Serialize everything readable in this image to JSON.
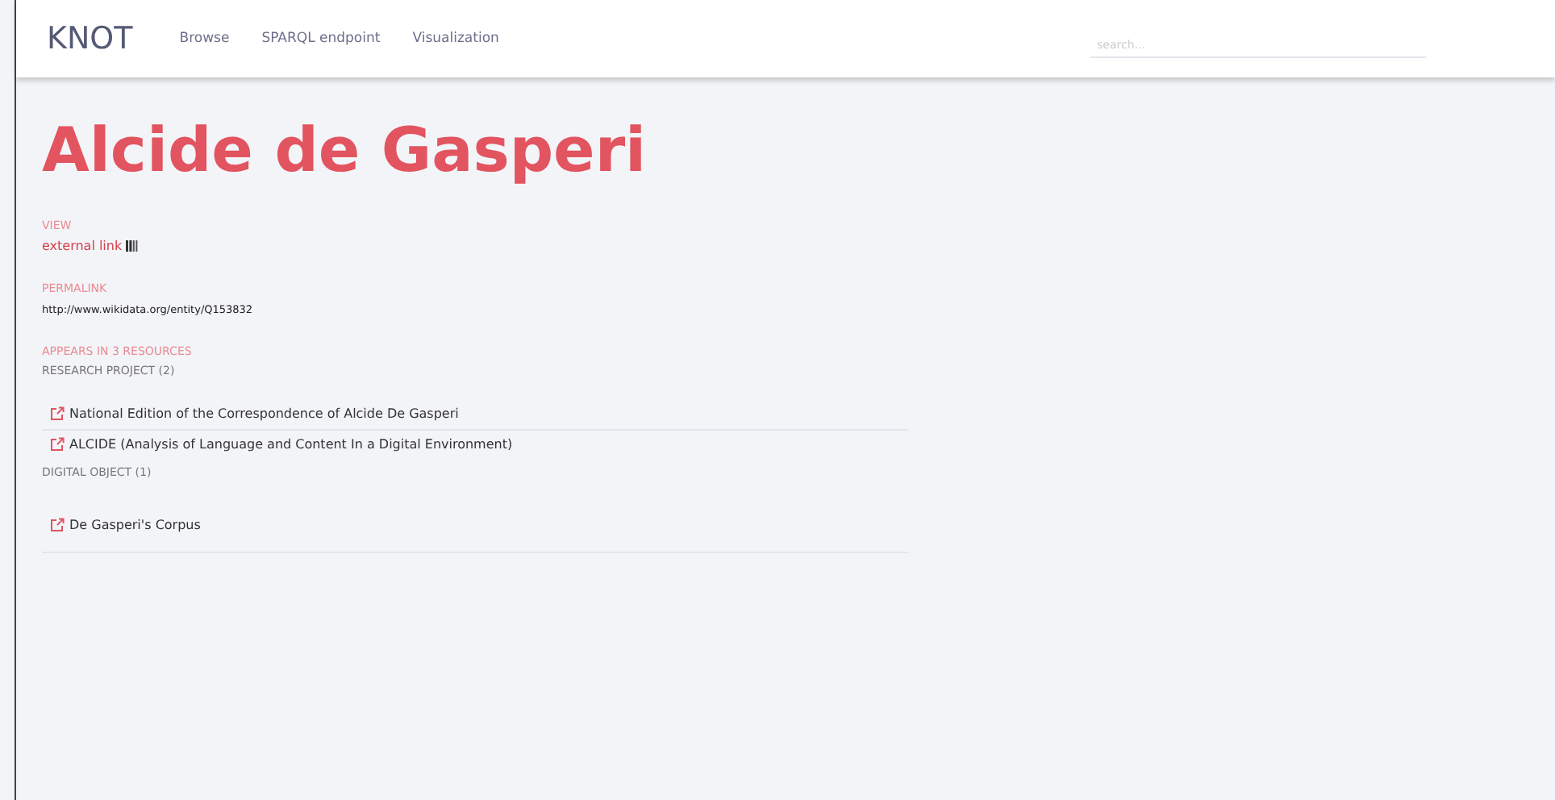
{
  "header": {
    "brand": "KNOT",
    "links": [
      "Browse",
      "SPARQL endpoint",
      "Visualization"
    ],
    "search": {
      "placeholder": "search..."
    }
  },
  "title": "Alcide de Gasperi",
  "view": {
    "label": "VIEW",
    "link": "external link"
  },
  "permalink": {
    "label": "PERMALINK",
    "url": "http://www.wikidata.org/entity/Q153832"
  },
  "appears": {
    "label": "APPEARS IN 3 RESOURCES",
    "groups": [
      {
        "heading": "RESEARCH PROJECT (2)",
        "items": [
          "National Edition of the Correspondence of Alcide De Gasperi",
          "ALCIDE (Analysis of Language and Content In a Digital Environment)"
        ]
      },
      {
        "heading": "DIGITAL OBJECT (1)",
        "items": [
          "De Gasperi's Corpus"
        ]
      }
    ]
  }
}
